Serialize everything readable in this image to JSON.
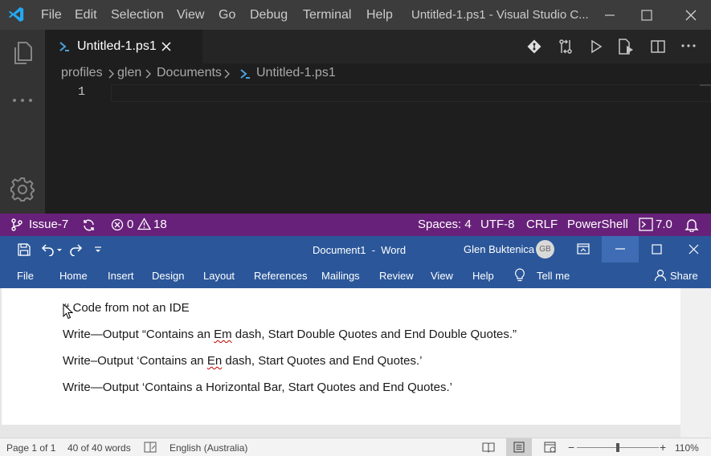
{
  "vscode": {
    "menu": [
      "File",
      "Edit",
      "Selection",
      "View",
      "Go",
      "Debug",
      "Terminal",
      "Help"
    ],
    "window_title": "Untitled-1.ps1 - Visual Studio C...",
    "tab_label": "Untitled-1.ps1",
    "breadcrumb": [
      "profiles",
      "glen",
      "Documents",
      "Untitled-1.ps1"
    ],
    "line_number": "1",
    "status": {
      "branch": "Issue-7",
      "errors": "0",
      "warnings": "18",
      "spaces": "Spaces: 4",
      "encoding": "UTF-8",
      "eol": "CRLF",
      "language": "PowerShell",
      "version": "7.0"
    },
    "colors": {
      "statusbar": "#68217a",
      "accent": "#007acc"
    }
  },
  "word": {
    "doc_title": "Document1  -  Word",
    "user_name": "Glen Buktenica",
    "user_initials": "GB",
    "ribbon_tabs": [
      "File",
      "Home",
      "Insert",
      "Design",
      "Layout",
      "References",
      "Mailings",
      "Review",
      "View",
      "Help"
    ],
    "tell_me": "Tell me",
    "share": "Share",
    "lines": [
      "# Code from not an IDE",
      "Write—Output “Contains an Em dash, Start Double Quotes and End Double Quotes.”",
      "Write–Output ‘Contains an En dash, Start Quotes and End Quotes.’",
      "Write―Output ‘Contains a Horizontal Bar, Start Quotes and End Quotes.’"
    ],
    "line_parts": {
      "l2a": "Write—Output “Contains an ",
      "l2b": "Em",
      "l2c": " dash, Start Double Quotes and End Double Quotes.”",
      "l3a": "Write–Output ‘Contains an ",
      "l3b": "En",
      "l3c": " dash, Start Quotes and End Quotes.’"
    },
    "status": {
      "page": "Page 1 of 1",
      "words": "40 of 40 words",
      "language": "English (Australia)",
      "zoom": "110%",
      "zoom_minus": "−",
      "zoom_plus": "+"
    },
    "colors": {
      "brand": "#2b579a"
    }
  }
}
